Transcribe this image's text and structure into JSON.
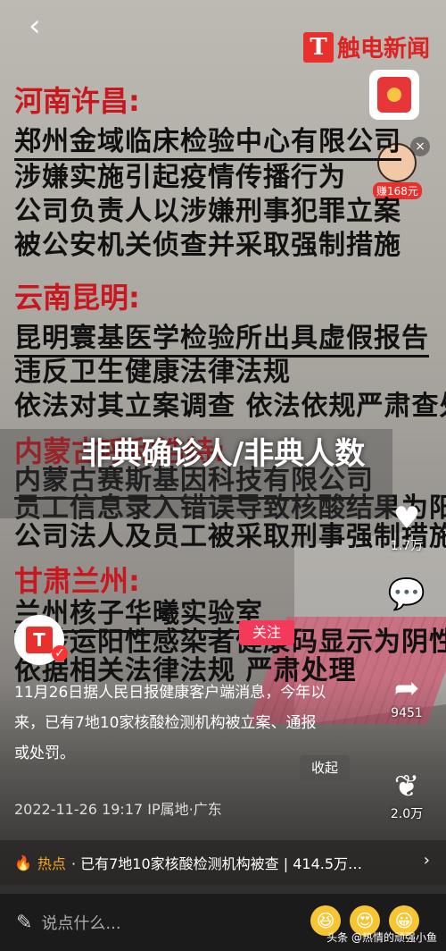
{
  "nav": {
    "back_icon": "‹"
  },
  "brand": {
    "logo_letter": "T",
    "logo_text": "触电新闻"
  },
  "promo": {
    "price": "赚168元"
  },
  "post": {
    "sections": [
      {
        "heading": "河南许昌:",
        "lines": [
          "郑州金域临床检验中心有限公司",
          "涉嫌实施引起疫情传播行为",
          "公司负责人以涉嫌刑事犯罪立案",
          "被公安机关侦查并采取强制措施"
        ]
      },
      {
        "heading": "云南昆明:",
        "lines": [
          "昆明寰基医学检验所出具虚假报告",
          "违反卫生健康法律法规",
          "依法对其立案调查 依法依规严肃查处"
        ]
      },
      {
        "heading": "内蒙古呼和浩特:",
        "lines": [
          "内蒙古赛斯基因科技有限公司",
          "员工信息录入错误导致核酸结果为阳性",
          "公司法人及员工被采取刑事强制措施"
        ]
      },
      {
        "heading": "甘肃兰州:",
        "lines": [
          "兰州核子华曦实验室",
          "将转运阳性感染者健康码显示为阴性",
          "依据相关法律法规 严肃处理"
        ]
      }
    ]
  },
  "overlay": {
    "title": "非典确诊人/非典人数"
  },
  "sidebar": {
    "like_count": "1.7万",
    "share_count": "9451",
    "fav_count": "2.0万"
  },
  "account": {
    "follow_label": "关注",
    "mark": "T"
  },
  "caption": {
    "text": "11月26日据人民日报健康客户端消息，今年以来，已有7地10家核酸检测机构被立案、通报或处罚。",
    "collapse_label": "收起",
    "meta": "2022-11-26 19:17 IP属地·广东"
  },
  "hotbar": {
    "label": "热点",
    "text": "· 已有7地10家核酸检测机构被查 | 414.5万…",
    "chevron": "›"
  },
  "bottom": {
    "placeholder": "说点什么...",
    "watermark": "头条 @热情的顽强小鱼"
  }
}
